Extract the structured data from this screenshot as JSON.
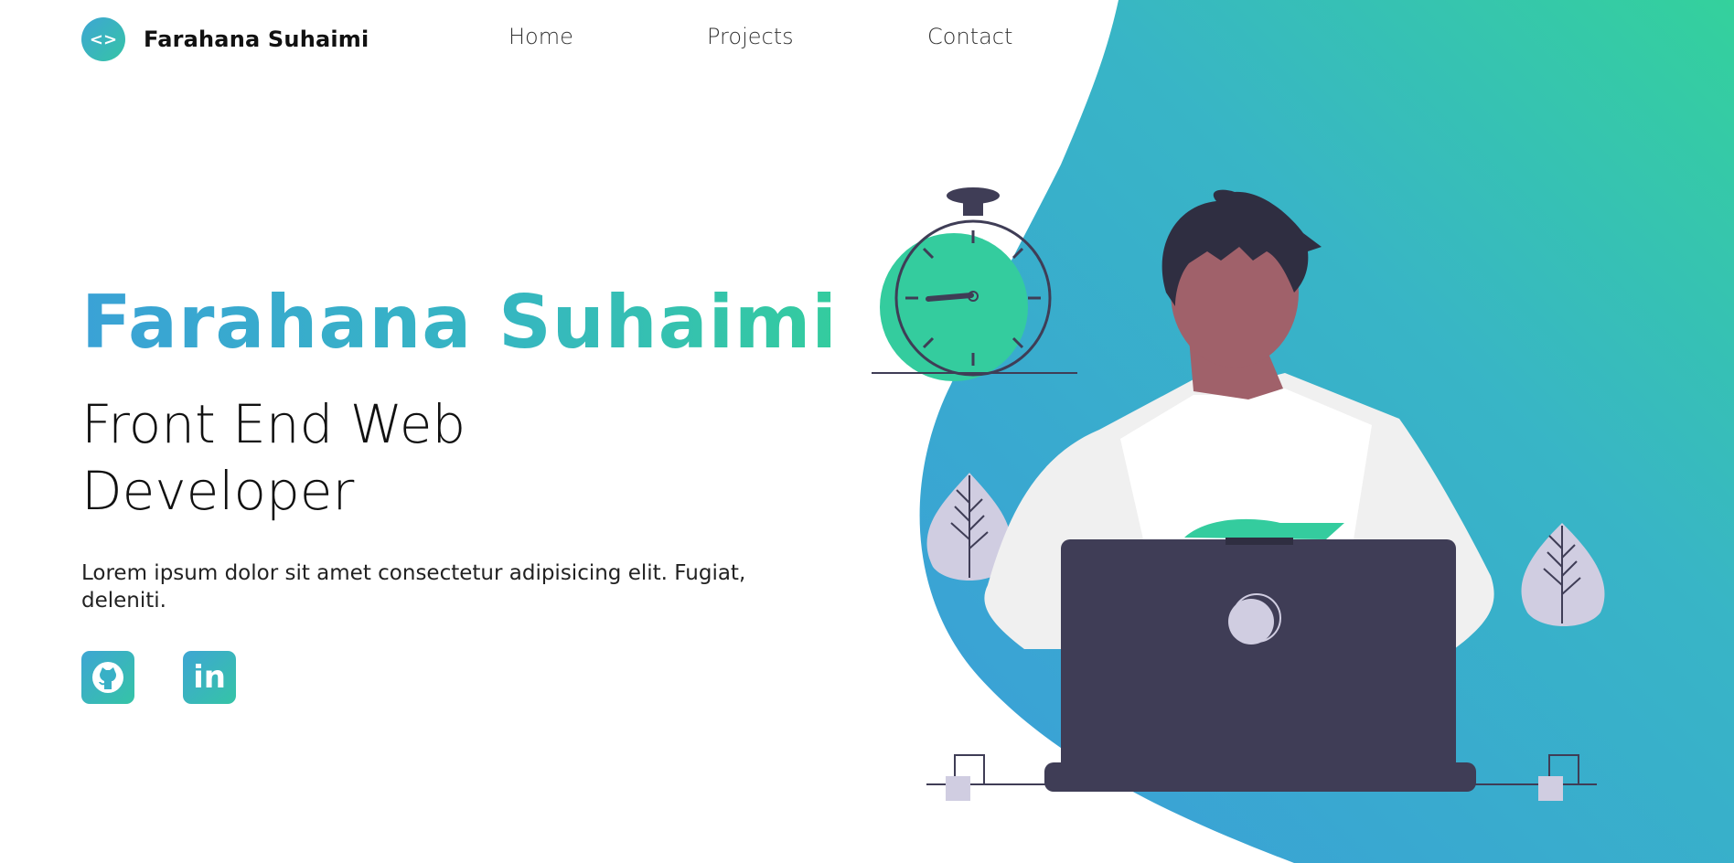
{
  "header": {
    "brand_logo_glyph": "<>",
    "brand_name": "Farahana Suhaimi",
    "nav": {
      "home": "Home",
      "projects": "Projects",
      "contact": "Contact"
    }
  },
  "hero": {
    "title": "Farahana Suhaimi",
    "role": "Front End Web Developer",
    "description": "Lorem ipsum dolor sit amet consectetur adipisicing elit. Fugiat, deleniti."
  },
  "social": {
    "github_icon": "github-icon",
    "linkedin_glyph": "in"
  },
  "colors": {
    "gradient_start": "#3aa2d6",
    "gradient_end": "#34cc9e",
    "laptop": "#3f3d56",
    "hair": "#2f2e41",
    "skin": "#a0616a",
    "shirt": "#f0f0f0",
    "leaf": "#d0cde1"
  }
}
